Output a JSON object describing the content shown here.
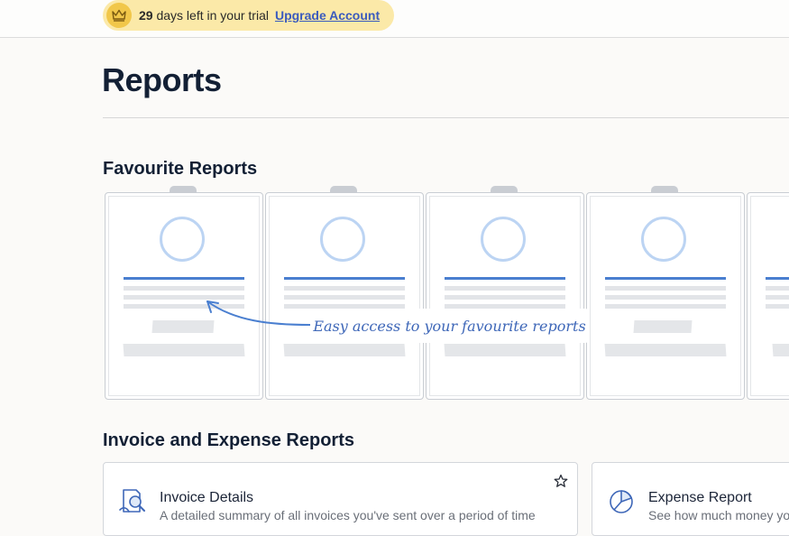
{
  "trial_banner": {
    "days": "29",
    "text": "days left in your trial",
    "upgrade_label": "Upgrade Account"
  },
  "page": {
    "title": "Reports"
  },
  "favourites": {
    "title": "Favourite Reports",
    "callout": "Easy access to your favourite reports"
  },
  "invoice_section": {
    "title": "Invoice and Expense Reports",
    "cards": [
      {
        "title": "Invoice Details",
        "description": "A detailed summary of all invoices you've sent over a period of time",
        "icon": "magnifier-document-icon"
      },
      {
        "title": "Expense Report",
        "description": "See how much money yo",
        "icon": "pie-chart-icon"
      }
    ]
  },
  "colors": {
    "accent": "#3b5bbd",
    "trial_bg": "#fbe9a8",
    "crown": "#f1c74a",
    "placeholder_blue": "#4a7fd0"
  }
}
